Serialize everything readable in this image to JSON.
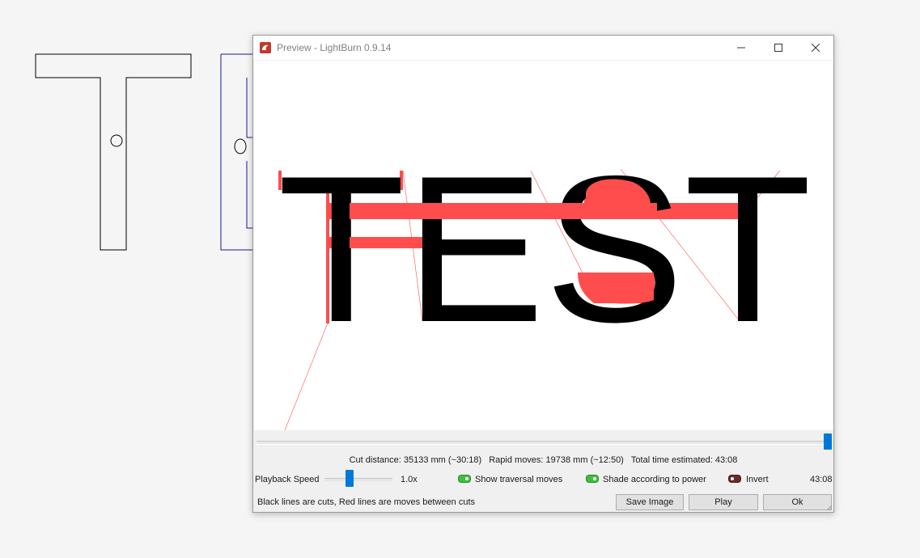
{
  "window": {
    "title": "Preview - LightBurn 0.9.14",
    "minimize_icon": "minimize-icon",
    "maximize_icon": "maximize-icon",
    "close_icon": "close-icon",
    "app_icon": "lightburn-logo-icon"
  },
  "preview": {
    "text": "TEST",
    "cut_color": "#000000",
    "move_color": "#ff4d4d"
  },
  "stats": {
    "cut_distance": "Cut distance: 35133 mm (~30:18)",
    "rapid_moves": "Rapid moves: 19738 mm (~12:50)",
    "total_time": "Total time estimated: 43:08"
  },
  "controls": {
    "playback_speed_label": "Playback Speed",
    "playback_speed_value": "1.0x",
    "show_traversal_label": "Show traversal moves",
    "show_traversal_on": true,
    "shade_power_label": "Shade according to power",
    "shade_power_on": true,
    "invert_label": "Invert",
    "invert_on": false,
    "elapsed_time": "43:08",
    "scrubber_position": 1.0
  },
  "footer": {
    "note": "Black lines are cuts, Red lines are moves between cuts",
    "save_image_label": "Save Image",
    "play_label": "Play",
    "ok_label": "Ok"
  },
  "colors": {
    "accent": "#0078d7",
    "toggle_on": "#3fbf3f",
    "toggle_off": "#6b2a2a",
    "background_design_stroke": "#1a1a8c"
  }
}
